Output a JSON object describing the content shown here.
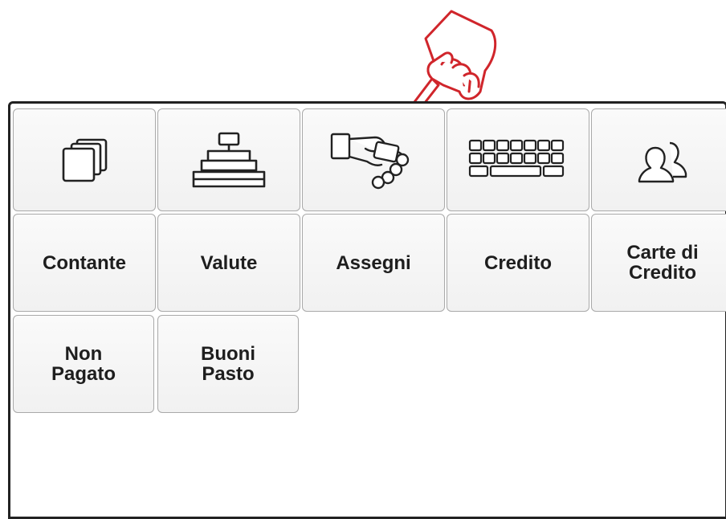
{
  "icons": [
    {
      "name": "stacked-cards-icon"
    },
    {
      "name": "cash-register-icon"
    },
    {
      "name": "hand-payment-icon"
    },
    {
      "name": "keyboard-icon"
    },
    {
      "name": "users-icon"
    }
  ],
  "buttons": [
    {
      "label": "Contante"
    },
    {
      "label": "Valute"
    },
    {
      "label": "Assegni"
    },
    {
      "label": "Credito"
    },
    {
      "label": "Carte di\nCredito"
    },
    {
      "label": "Non\nPagato"
    },
    {
      "label": "Buoni\nPasto"
    }
  ],
  "colors": {
    "pointer": "#d0252b",
    "border": "#a9a9a9",
    "text": "#1e1e1e"
  }
}
